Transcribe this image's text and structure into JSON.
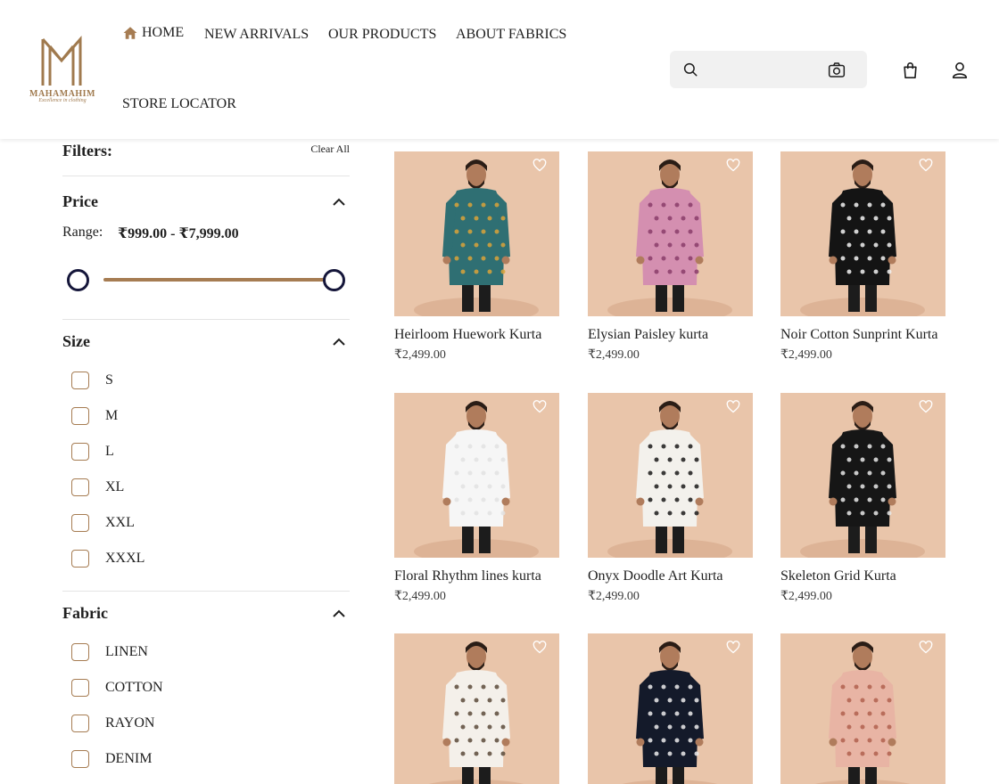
{
  "brand": {
    "name": "MAHAMAHIM",
    "tagline": "Excellence in clothing"
  },
  "nav": [
    "HOME",
    "NEW ARRIVALS",
    "OUR PRODUCTS",
    "ABOUT FABRICS",
    "STORE LOCATOR"
  ],
  "search": {
    "placeholder": ""
  },
  "filters": {
    "title": "Filters:",
    "clear_all": "Clear All",
    "price": {
      "title": "Price",
      "range_label": "Range:",
      "range_value": "₹999.00 - ₹7,999.00"
    },
    "size": {
      "title": "Size",
      "options": [
        "S",
        "M",
        "L",
        "XL",
        "XXL",
        "XXXL"
      ]
    },
    "fabric": {
      "title": "Fabric",
      "options": [
        "LINEN",
        "COTTON",
        "RAYON",
        "DENIM"
      ]
    }
  },
  "products": [
    {
      "name": "Heirloom Huework Kurta",
      "price": "₹2,499.00",
      "kurta_color": "#2f6f73",
      "pattern": "#d9a33a"
    },
    {
      "name": "Elysian Paisley kurta",
      "price": "₹2,499.00",
      "kurta_color": "#d48fb0",
      "pattern": "#8a3d6a"
    },
    {
      "name": "Noir Cotton Sunprint Kurta",
      "price": "₹2,499.00",
      "kurta_color": "#141414",
      "pattern": "#f2f2f2"
    },
    {
      "name": "Floral Rhythm lines kurta",
      "price": "₹2,499.00",
      "kurta_color": "#f6f6f6",
      "pattern": "#e2e2e2"
    },
    {
      "name": "Onyx Doodle Art Kurta",
      "price": "₹2,499.00",
      "kurta_color": "#f3f1ec",
      "pattern": "#1a1a1a"
    },
    {
      "name": "Skeleton Grid Kurta",
      "price": "₹2,499.00",
      "kurta_color": "#161616",
      "pattern": "#e9e9e9"
    },
    {
      "name": "",
      "price": "",
      "kurta_color": "#f4f0ea",
      "pattern": "#5a4a3a"
    },
    {
      "name": "",
      "price": "",
      "kurta_color": "#141a2a",
      "pattern": "#ececec"
    },
    {
      "name": "",
      "price": "",
      "kurta_color": "#e8b4a4",
      "pattern": "#b0604f"
    }
  ]
}
